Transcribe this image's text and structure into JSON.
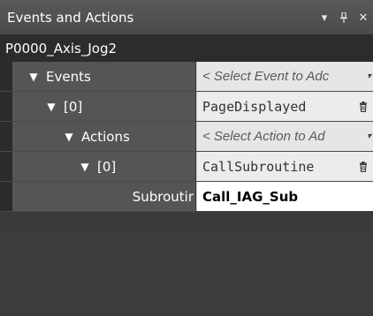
{
  "panel": {
    "title": "Events and Actions",
    "controls": {
      "pin_icon": "pin-icon",
      "dropdown_icon": "chevron-down-icon",
      "close_icon": "close-icon"
    }
  },
  "page_name": "P0000_Axis_Jog2",
  "rows": [
    {
      "label": "Events",
      "value": "< Select Event to Adc",
      "kind": "dropdown"
    },
    {
      "label": "[0]",
      "value": "PageDisplayed",
      "kind": "item"
    },
    {
      "label": "Actions",
      "value": "< Select Action to Ad",
      "kind": "dropdown"
    },
    {
      "label": "[0]",
      "value": "CallSubroutine",
      "kind": "item"
    },
    {
      "label": "Subroutir",
      "value": "Call_IAG_Sub",
      "kind": "input"
    }
  ],
  "colors": {
    "panel_bg": "#3a3a3a",
    "title_bg": "#4f4f4f",
    "row_bg": "#555555"
  }
}
